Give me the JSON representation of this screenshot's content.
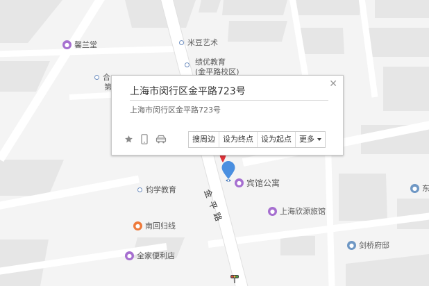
{
  "popup": {
    "title": "上海市闵行区金平路723号",
    "address": "上海市闵行区金平路723号",
    "close_icon": "close-icon",
    "tool_icons": [
      "star-icon",
      "phone-icon",
      "car-icon"
    ],
    "actions": {
      "search_nearby": "搜周边",
      "set_destination": "设为终点",
      "set_start": "设为起点",
      "more": "更多"
    }
  },
  "road": {
    "name": "金平路"
  },
  "pois": [
    {
      "name": "馨兰堂",
      "icon": "purple"
    },
    {
      "name": "米豆艺术",
      "icon": "dot"
    },
    {
      "name": "绩优教育",
      "icon": "dot"
    },
    {
      "name": "(金平路校区)",
      "icon": ""
    },
    {
      "name": "合",
      "icon": "dot"
    },
    {
      "name": "第",
      "icon": ""
    },
    {
      "name": "宾馆公寓",
      "icon": "purple"
    },
    {
      "name": "钧学教育",
      "icon": "dot"
    },
    {
      "name": "上海欣源旅馆",
      "icon": "purple"
    },
    {
      "name": "南回归线",
      "icon": "orange"
    },
    {
      "name": "剑桥府邸",
      "icon": "blue"
    },
    {
      "name": "全家便利店",
      "icon": "purple"
    },
    {
      "name": "东",
      "icon": "blue"
    }
  ],
  "colors": {
    "marker": "#4a8fe0",
    "marker_behind": "#e0333a",
    "poi_purple": "#a66fd0",
    "poi_orange": "#ee7a3b",
    "poi_blue": "#6e97c4"
  }
}
